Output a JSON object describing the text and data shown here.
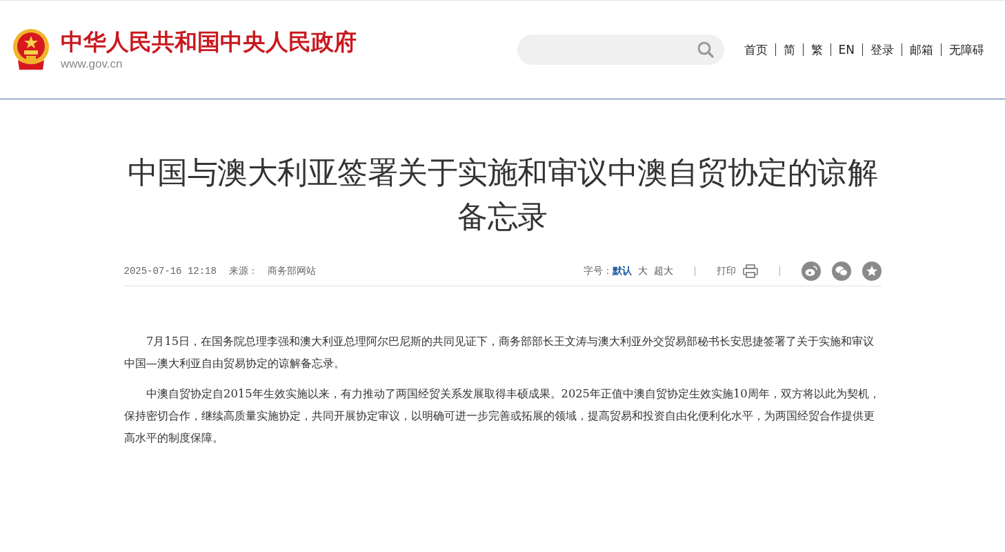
{
  "header": {
    "logo": {
      "title": "中华人民共和国中央人民政府",
      "url": "www.gov.cn"
    },
    "nav": [
      {
        "label": "首页"
      },
      {
        "label": "简"
      },
      {
        "label": "繁"
      },
      {
        "label": "EN"
      },
      {
        "label": "登录"
      },
      {
        "label": "邮箱"
      },
      {
        "label": "无障碍"
      }
    ]
  },
  "article": {
    "title": "中国与澳大利亚签署关于实施和审议中澳自贸协定的谅解备忘录",
    "date": "2025-07-16 12:18",
    "source_label": "来源：",
    "source": "商务部网站",
    "font_size_label": "字号：",
    "font_sizes": [
      {
        "label": "默认",
        "selected": true
      },
      {
        "label": "大",
        "selected": false
      },
      {
        "label": "超大",
        "selected": false
      }
    ],
    "print_label": "打印",
    "paragraphs": [
      "7月15日，在国务院总理李强和澳大利亚总理阿尔巴尼斯的共同见证下，商务部部长王文涛与澳大利亚外交贸易部秘书长安思捷签署了关于实施和审议中国—澳大利亚自由贸易协定的谅解备忘录。",
      "中澳自贸协定自2015年生效实施以来，有力推动了两国经贸关系发展取得丰硕成果。2025年正值中澳自贸协定生效实施10周年，双方将以此为契机，保持密切合作，继续高质量实施协定，共同开展协定审议，以明确可进一步完善或拓展的领域，提高贸易和投资自由化便利化水平，为两国经贸合作提供更高水平的制度保障。"
    ]
  }
}
